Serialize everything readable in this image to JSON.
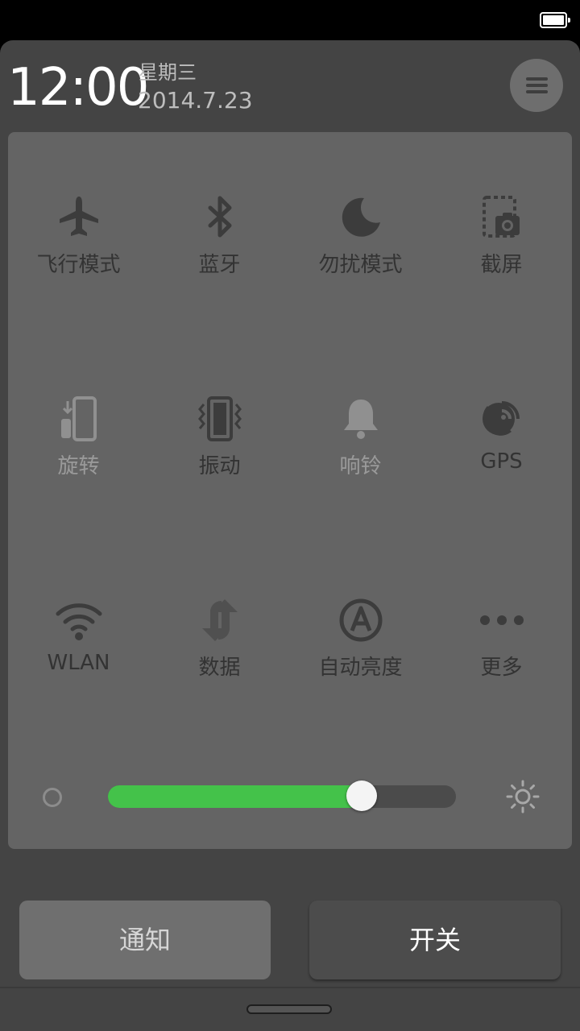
{
  "header": {
    "time": "12:00",
    "weekday": "星期三",
    "date": "2014.7.23"
  },
  "toggles": [
    {
      "label": "飞行模式",
      "icon": "airplane-icon"
    },
    {
      "label": "蓝牙",
      "icon": "bluetooth-icon"
    },
    {
      "label": "勿扰模式",
      "icon": "moon-icon"
    },
    {
      "label": "截屏",
      "icon": "screenshot-icon"
    },
    {
      "label": "旋转",
      "icon": "rotate-icon"
    },
    {
      "label": "振动",
      "icon": "vibrate-icon"
    },
    {
      "label": "响铃",
      "icon": "bell-icon"
    },
    {
      "label": "GPS",
      "icon": "gps-icon"
    },
    {
      "label": "WLAN",
      "icon": "wifi-icon"
    },
    {
      "label": "数据",
      "icon": "data-icon"
    },
    {
      "label": "自动亮度",
      "icon": "auto-brightness-icon"
    },
    {
      "label": "更多",
      "icon": "more-icon"
    }
  ],
  "brightness": {
    "level": 0.73
  },
  "bottom": {
    "notify_label": "通知",
    "switch_label": "开关"
  },
  "colors": {
    "accent": "#44c24a",
    "panel": "#444444",
    "card": "#646464"
  }
}
